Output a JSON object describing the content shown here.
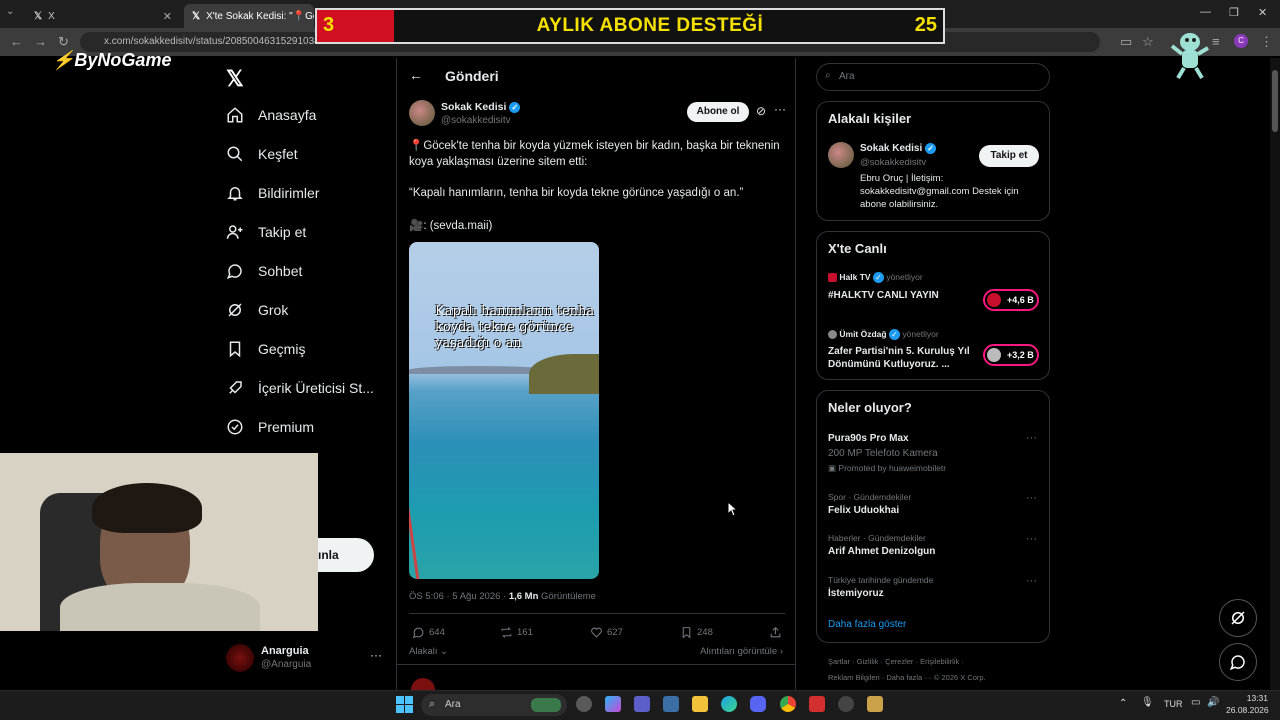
{
  "browser": {
    "tabs": [
      {
        "label": "X"
      },
      {
        "label": "X'te Sokak Kedisi: \"📍Göce"
      }
    ],
    "url": "x.com/sokakkedisitv/status/2085004631529103451"
  },
  "overlay": {
    "banner_title": "AYLIK ABONE DESTEĞİ",
    "banner_left": "3",
    "banner_right": "25",
    "brand": "ByNoGame"
  },
  "nav": {
    "items": [
      {
        "label": "Anasayfa",
        "icon": "home-icon"
      },
      {
        "label": "Keşfet",
        "icon": "search-icon"
      },
      {
        "label": "Bildirimler",
        "icon": "bell-icon"
      },
      {
        "label": "Takip et",
        "icon": "person-add-icon"
      },
      {
        "label": "Sohbet",
        "icon": "chat-icon"
      },
      {
        "label": "Grok",
        "icon": "grok-icon"
      },
      {
        "label": "Geçmiş",
        "icon": "bookmark-icon"
      },
      {
        "label": "İçerik Üreticisi St...",
        "icon": "rocket-icon"
      },
      {
        "label": "Premium",
        "icon": "verified-icon"
      }
    ],
    "post_button_partial": "ınla",
    "account": {
      "name": "Anarguia",
      "handle": "@Anarguia"
    }
  },
  "post": {
    "header_title": "Gönderi",
    "author_name": "Sokak Kedisi",
    "author_handle": "@sokakkedisitv",
    "follow_label": "Abone ol",
    "text_line1": "📍Göcek'te tenha bir koyda yüzmek isteyen bir kadın, başka bir teknenin koya yaklaşması üzerine sitem etti:",
    "text_line2": "“Kapalı hanımların, tenha bir koyda tekne görünce yaşadığı o an.”",
    "text_line3": "🎥: (sevda.maii)",
    "media_caption": "Kapalı hanımların tenha koyda tekne görünce yaşadığı o an",
    "time": "ÖS 5:06 · 5 Ağu 2026 ·",
    "views": "1,6 Mn",
    "views_label": "Görüntüleme",
    "replies": "644",
    "reposts": "161",
    "likes": "627",
    "bookmarks": "248",
    "relevant_label": "Alakalı",
    "quotes_label": "Alıntıları görüntüle"
  },
  "sidebar": {
    "search_placeholder": "Ara",
    "related_title": "Alakalı kişiler",
    "related": {
      "name": "Sokak Kedisi",
      "handle": "@sokakkedisitv",
      "follow_label": "Takip et",
      "bio": "Ebru Oruç | İletişim: sokakkedisitv@gmail.com Destek için abone olabilirsiniz."
    },
    "live_title": "X'te Canlı",
    "live": [
      {
        "host": "Halk TV",
        "status": "yönetliyor",
        "title": "#HALKTV CANLI YAYIN",
        "count": "+4,6 B"
      },
      {
        "host": "Ümit Özdağ",
        "status": "yönetliyor",
        "title": "Zafer Partisi'nin 5. Kuruluş Yıl Dönümünü Kutluyoruz. ...",
        "count": "+3,2 B"
      }
    ],
    "trends_title": "Neler oluyor?",
    "trends": [
      {
        "context": "",
        "name": "Pura90s Pro Max",
        "sub": "200 MP Telefoto Kamera",
        "promo": "Promoted by huaweimobiletr"
      },
      {
        "context": "Spor · Gündemdekiler",
        "name": "Felix Uduokhai",
        "sub": "",
        "promo": ""
      },
      {
        "context": "Haberler · Gündemdekiler",
        "name": "Arif Ahmet Denizolgun",
        "sub": "",
        "promo": ""
      },
      {
        "context": "Türkiye tarihinde gündemde",
        "name": "İstemiyoruz",
        "sub": "",
        "promo": ""
      }
    ],
    "show_more": "Daha fazla göster",
    "footer_line1": "Şartlar · Gizlilik · Çerezler · Erişilebilirlik ·",
    "footer_line2": "Reklam Bilgileri · Daha fazla ··· © 2026 X Corp."
  },
  "taskbar": {
    "search_label": "Ara",
    "lang": "TUR",
    "time": "13:31",
    "date": "26.08.2026"
  }
}
